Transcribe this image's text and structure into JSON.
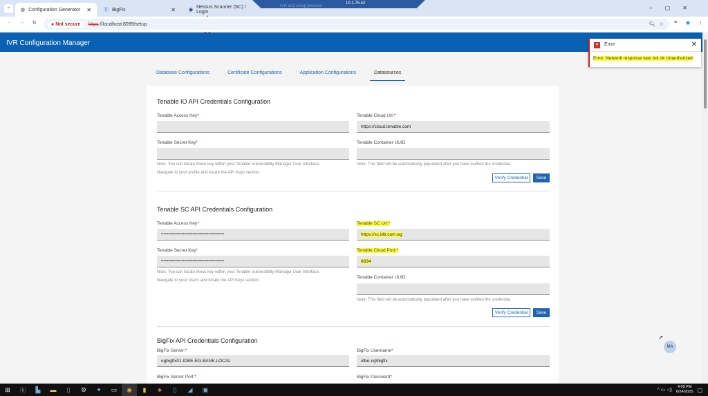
{
  "browser": {
    "tabs": [
      {
        "label": "Configuration Generator"
      },
      {
        "label": "BigFix"
      },
      {
        "label": "Nessus Scanner (SC) / Login"
      }
    ],
    "rdp_title": "10.1.75.42",
    "rdp_tab": "IVR and setup process",
    "security": "Not secure",
    "url_scheme": "https",
    "url_rest": "://localhost:8099/setup"
  },
  "app": {
    "title": "IVR Configuration Manager",
    "avatar": "MA"
  },
  "nav": {
    "tabs": [
      "Database Configurations",
      "Certificate Configurations",
      "Application Configurations",
      "Datasources"
    ],
    "active": "Datasources"
  },
  "io": {
    "title": "Tenable IO API Credentials Configuration",
    "access_key_label": "Tenable Access Key",
    "secret_key_label": "Tenable Secret Key",
    "cloud_url_label": "Tenable Cloud Url:",
    "cloud_url_value": "https://cloud.tenable.com",
    "uuid_label": "Tenable Container UUID",
    "note_left_1": "Note: You can locate these key within your Tenable Vulnerability Manager User Interface.",
    "note_left_2": "Navigate to your profile and locate the API Keys section.",
    "note_right": "Note: This field will be automatically populated after you have verified the credential.",
    "verify": "Verify Credential",
    "save": "Save"
  },
  "sc": {
    "title": "Tenable SC API Credentials Configuration",
    "access_key_label": "Tenable Access Key",
    "access_key_value": "••••••••••••••••••••••••••••••••••••••••••••••••••••",
    "secret_key_label": "Tenable Secret Key",
    "secret_key_value": "••••••••••••••••••••••••••••••••••••••••••••••••••••",
    "sc_url_label": "Tenable SC Url:",
    "sc_url_value": "https://sc.idb.com.eg",
    "port_label": "Tenable Cloud Port:",
    "port_value": "8834",
    "uuid_label": "Tenable Container UUID",
    "note_left_1": "Note: You can locate these key within your Tenable Vulnerability Manager User Interface.",
    "note_left_2": "Navigate to your Users and locate the API Keys section.",
    "note_right": "Note: This field will be automatically populated after you have verified the credential.",
    "verify": "Verify Credential",
    "save": "Save"
  },
  "bigfix": {
    "title": "BigFix API Credentials Configuration",
    "server_label": "BigFix Server:",
    "server_value": "egbigfix01.IDBE-EG.BANK.LOCAL",
    "username_label": "BigFix Username",
    "username_value": "idbe-eg\\bigfix",
    "port_label": "BigFix Server Port:",
    "password_label": "BigFix Password"
  },
  "req": "*",
  "toast": {
    "title": "Error",
    "message": "Error: Network response was not ok Unauthorized"
  },
  "taskbar": {
    "time": "4:09 PM",
    "date": "6/24/2025"
  },
  "colors": {
    "header": "#0a61b3",
    "error": "#c62828",
    "highlight": "#ffff3b"
  }
}
